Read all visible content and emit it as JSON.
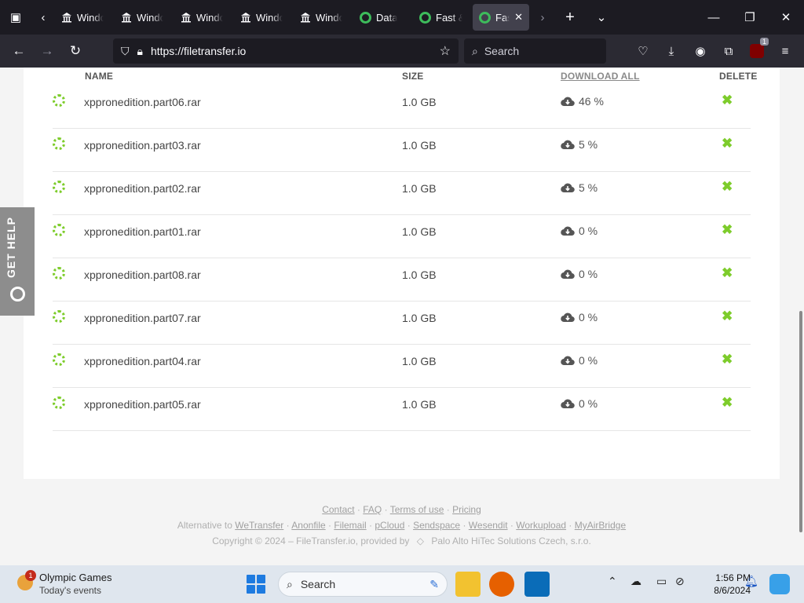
{
  "browser": {
    "tabs": [
      {
        "label": "Windows",
        "icon": "bank-icon",
        "active": false
      },
      {
        "label": "Windows",
        "icon": "bank-icon",
        "active": false
      },
      {
        "label": "Windows",
        "icon": "bank-icon",
        "active": false
      },
      {
        "label": "Windows",
        "icon": "bank-icon",
        "active": false
      },
      {
        "label": "Windows",
        "icon": "bank-icon",
        "active": false
      },
      {
        "label": "Data",
        "icon": "ring-icon",
        "active": false
      },
      {
        "label": "Fast &",
        "icon": "ring-icon",
        "active": false
      },
      {
        "label": "Fast",
        "icon": "ring-icon",
        "active": true
      }
    ],
    "url": "https://filetransfer.io",
    "search_placeholder": "Search",
    "ublock_count": "1"
  },
  "table": {
    "headers": {
      "name": "NAME",
      "size": "SIZE",
      "download_all": "DOWNLOAD ALL",
      "delete": "DELETE"
    },
    "rows": [
      {
        "name": "xppronedition.part06.rar",
        "size": "1.0 GB",
        "progress": "46 %"
      },
      {
        "name": "xppronedition.part03.rar",
        "size": "1.0 GB",
        "progress": "5 %"
      },
      {
        "name": "xppronedition.part02.rar",
        "size": "1.0 GB",
        "progress": "5 %"
      },
      {
        "name": "xppronedition.part01.rar",
        "size": "1.0 GB",
        "progress": "0 %"
      },
      {
        "name": "xppronedition.part08.rar",
        "size": "1.0 GB",
        "progress": "0 %"
      },
      {
        "name": "xppronedition.part07.rar",
        "size": "1.0 GB",
        "progress": "0 %"
      },
      {
        "name": "xppronedition.part04.rar",
        "size": "1.0 GB",
        "progress": "0 %"
      },
      {
        "name": "xppronedition.part05.rar",
        "size": "1.0 GB",
        "progress": "0 %"
      }
    ],
    "delete_glyph": "✖"
  },
  "get_help": "GET HELP",
  "footer": {
    "links": [
      "Contact",
      "FAQ",
      "Terms of use",
      "Pricing"
    ],
    "alternative_prefix": "Alternative to",
    "alternatives": [
      "WeTransfer",
      "Anonfile",
      "Filemail",
      "pCloud",
      "Sendspace",
      "Wesendit",
      "Workupload",
      "MyAirBridge"
    ],
    "copyright": "Copyright © 2024 – FileTransfer.io, provided by",
    "provider": "Palo Alto HiTec Solutions Czech, s.r.o."
  },
  "taskbar": {
    "widget_title": "Olympic Games",
    "widget_subtitle": "Today's events",
    "widget_badge": "1",
    "search_label": "Search",
    "time": "1:56 PM",
    "date": "8/6/2024"
  },
  "colors": {
    "accent_green": "#7dcc2b",
    "chrome_dark": "#1c1b22",
    "chrome_toolbar": "#2b2a33"
  }
}
